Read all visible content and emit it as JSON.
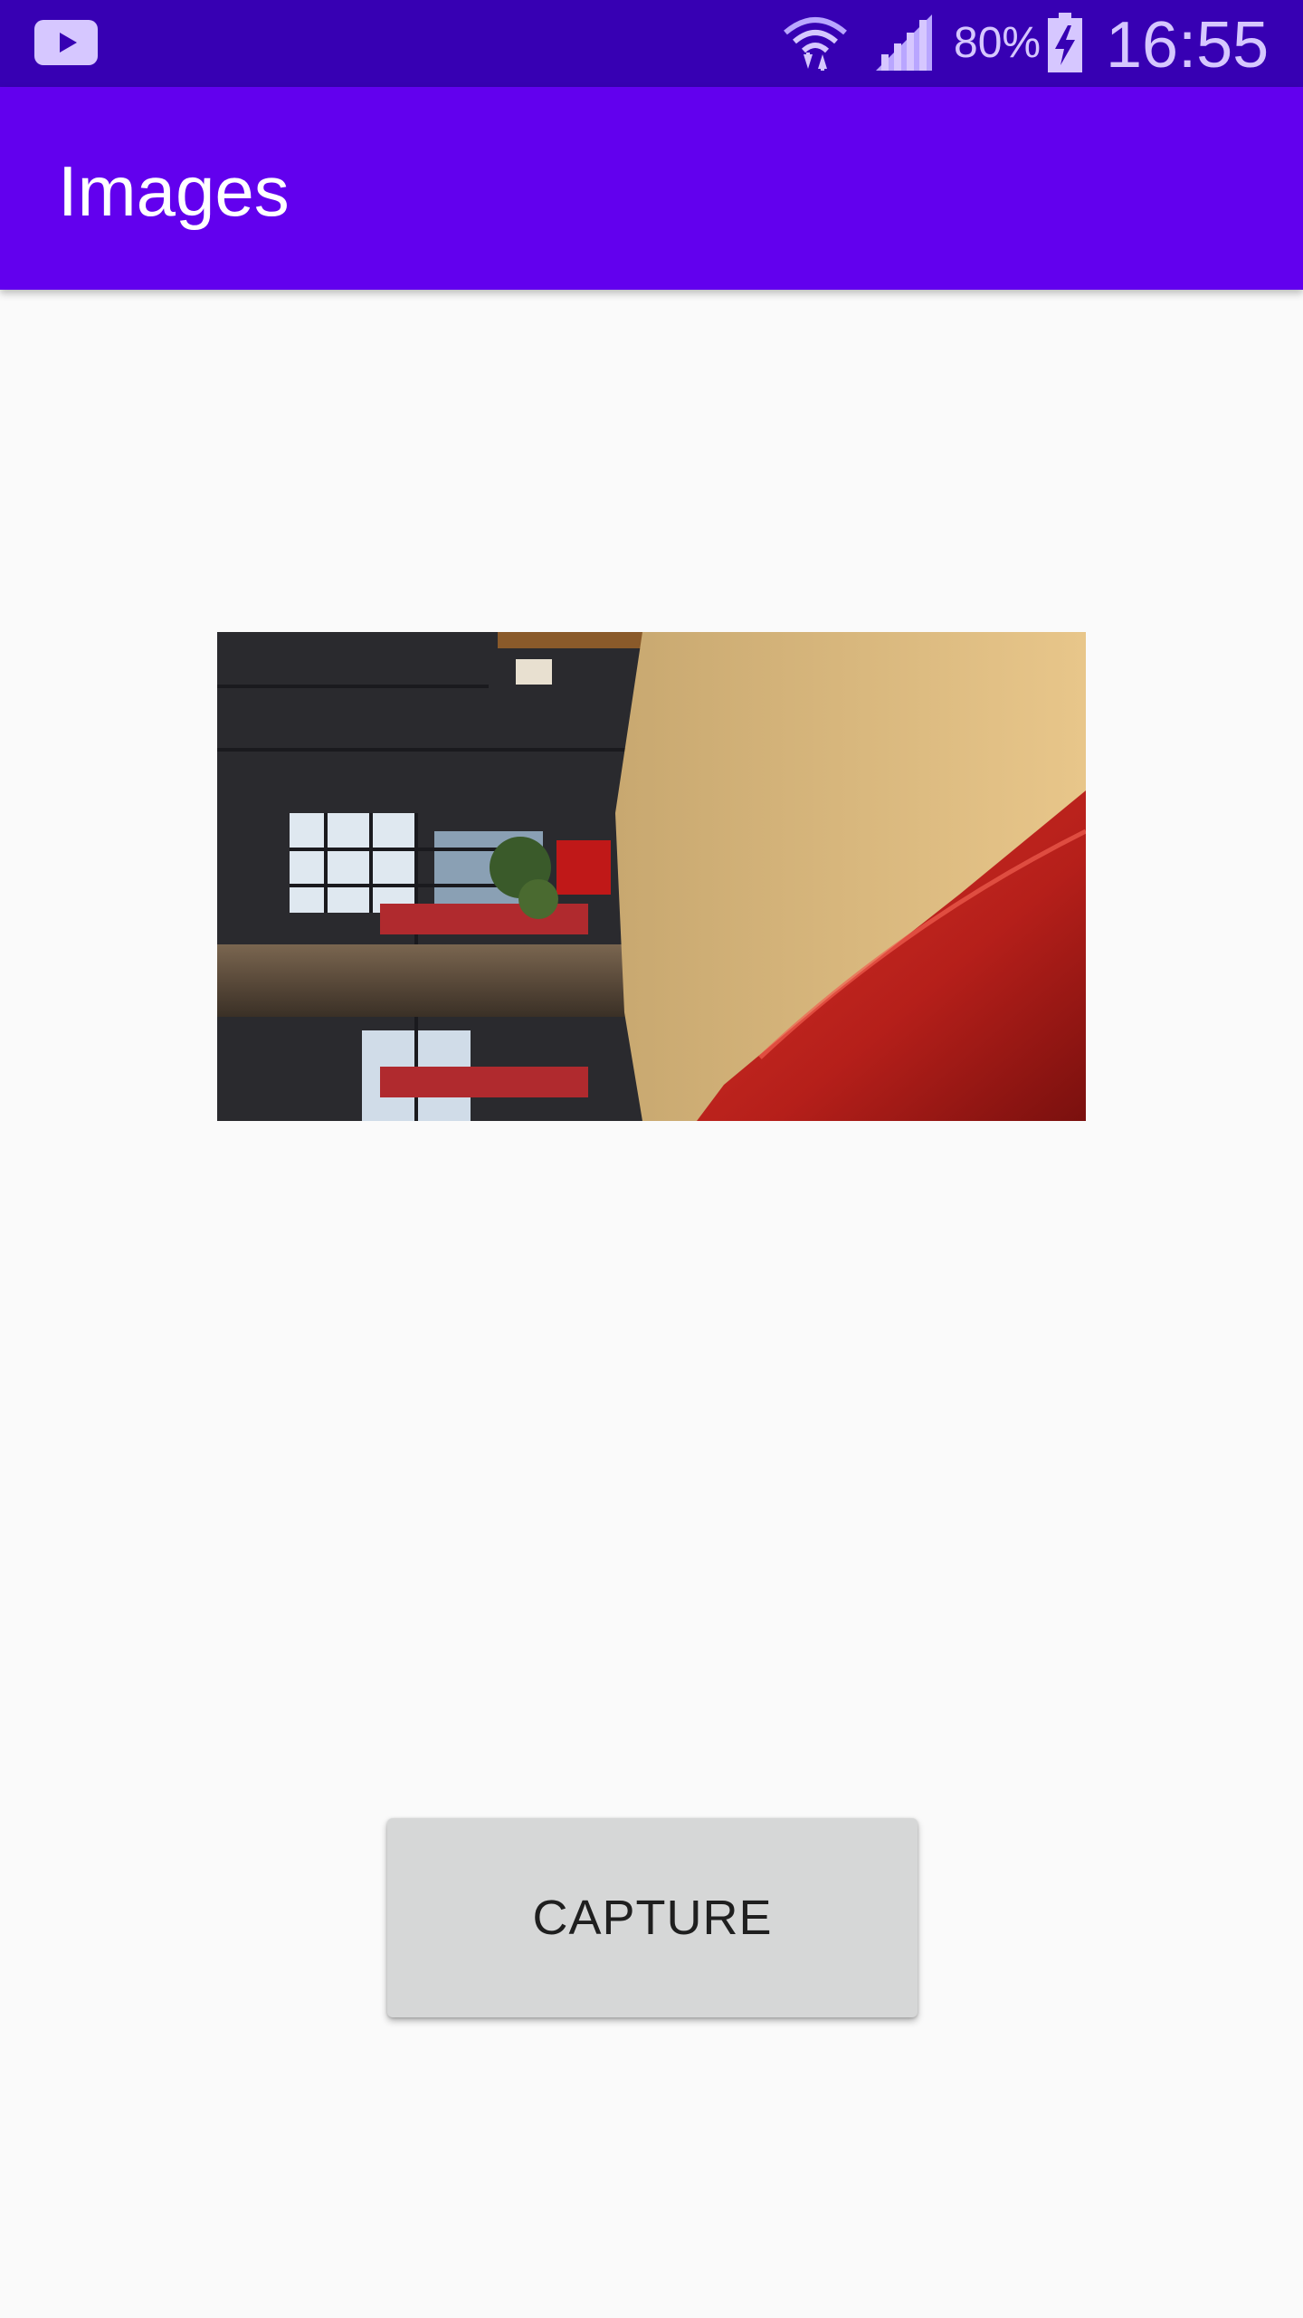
{
  "status_bar": {
    "notification_icon": "youtube-icon",
    "wifi_icon": "wifi-icon",
    "signal_icon": "cell-signal-icon",
    "battery_percent": "80%",
    "battery_icon": "battery-charging-icon",
    "battery_level": 0.8,
    "time": "16:55",
    "bg_color": "#3700b3"
  },
  "app_bar": {
    "title": "Images",
    "bg_color": "#6200ee"
  },
  "main": {
    "image": {
      "description_icon": "captured-photo",
      "rotation": "rotated 90 degrees"
    },
    "capture_button": {
      "label": "CAPTURE",
      "bg_color": "#d6d7d7"
    }
  }
}
